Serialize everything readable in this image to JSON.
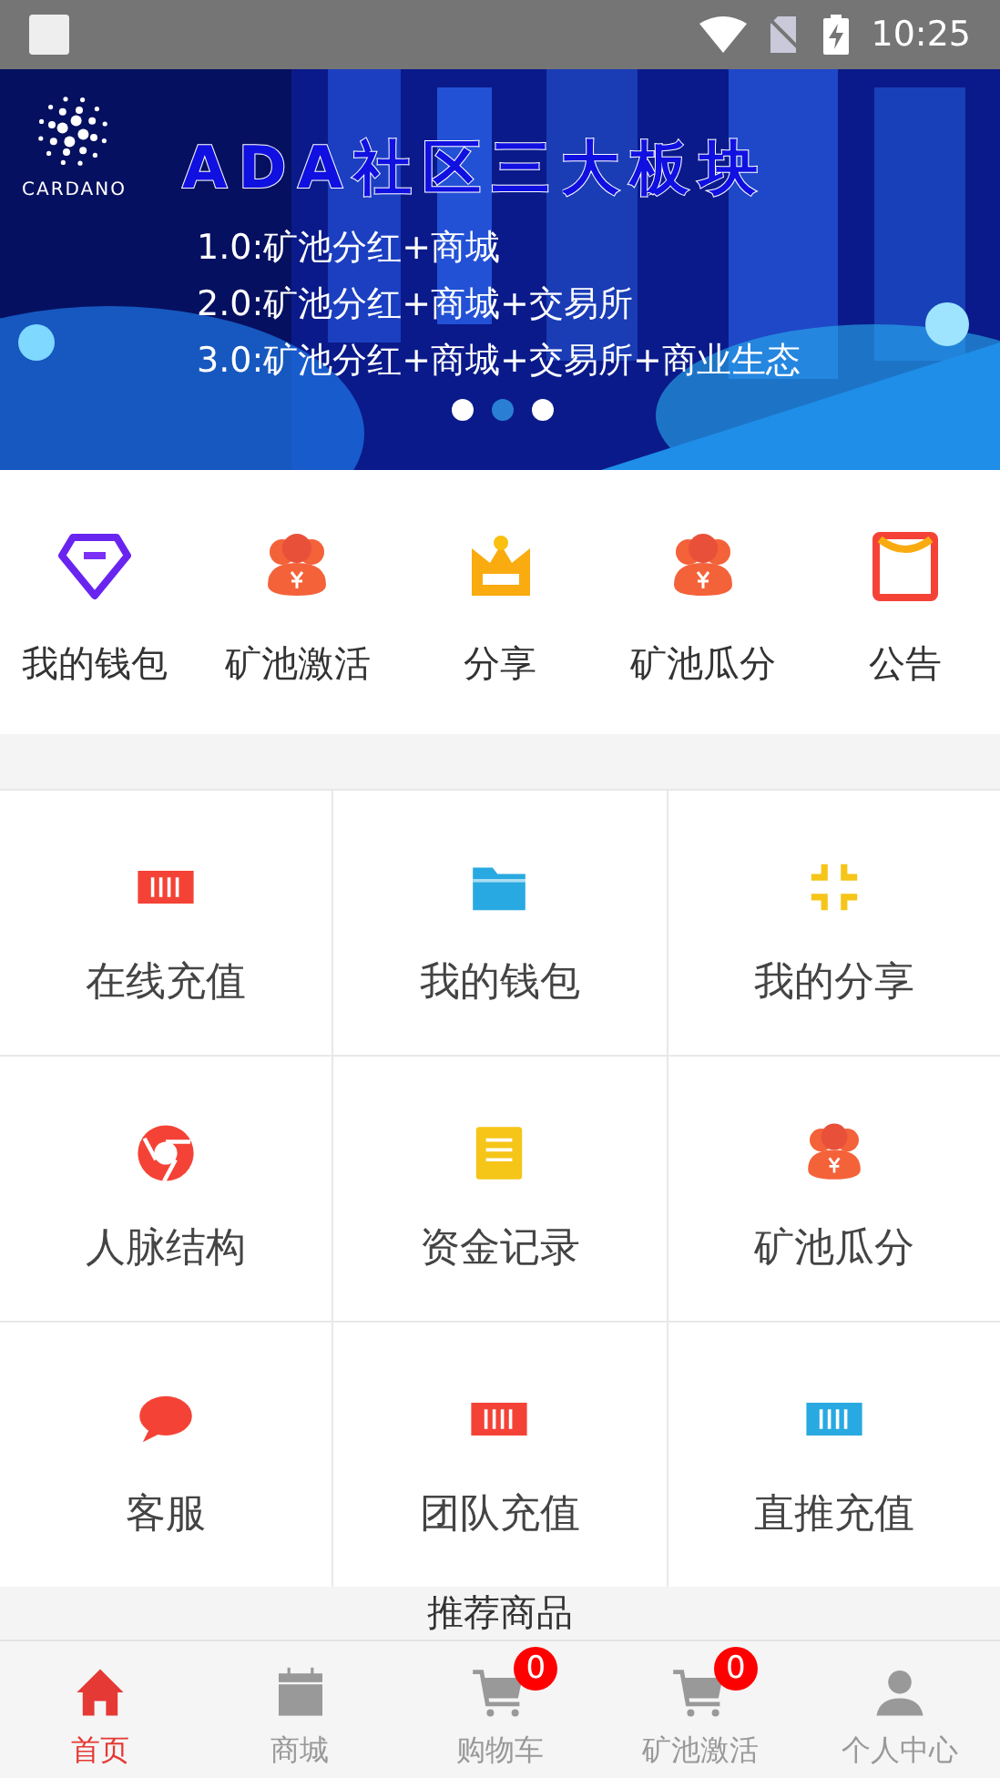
{
  "status_bar": {
    "time": "10:25"
  },
  "banner": {
    "logo_text": "CARDANO",
    "headline": "ADA社区三大板块",
    "lines": [
      "1.0:矿池分红+商城",
      "2.0:矿池分红+商城+交易所",
      "3.0:矿池分红+商城+交易所+商业生态"
    ],
    "dots": [
      {
        "selected": false
      },
      {
        "selected": true
      },
      {
        "selected": false
      }
    ]
  },
  "quick_menu": [
    {
      "label": "我的钱包",
      "kind": "diamond"
    },
    {
      "label": "矿池激活",
      "kind": "group"
    },
    {
      "label": "分享",
      "kind": "crown"
    },
    {
      "label": "矿池瓜分",
      "kind": "group"
    },
    {
      "label": "公告",
      "kind": "envelope"
    }
  ],
  "grid": [
    {
      "label": "在线充值",
      "kind": "card",
      "color": "#f44336"
    },
    {
      "label": "我的钱包",
      "kind": "folder",
      "color": "#29a9e1"
    },
    {
      "label": "我的分享",
      "kind": "shrink",
      "color": "#f5c518"
    },
    {
      "label": "人脉结构",
      "kind": "chrome",
      "color": "#f44336"
    },
    {
      "label": "资金记录",
      "kind": "note",
      "color": "#f5c518"
    },
    {
      "label": "矿池瓜分",
      "kind": "group",
      "color": "#f4623a"
    },
    {
      "label": "客服",
      "kind": "chat",
      "color": "#f44336"
    },
    {
      "label": "团队充值",
      "kind": "card",
      "color": "#f44336"
    },
    {
      "label": "直推充值",
      "kind": "card",
      "color": "#29a9e1"
    }
  ],
  "section_title": "推荐商品",
  "tabs": [
    {
      "label": "首页",
      "kind": "home",
      "selected": true
    },
    {
      "label": "商城",
      "kind": "calendar",
      "selected": false
    },
    {
      "label": "购物车",
      "kind": "cart",
      "selected": false,
      "badge": "0"
    },
    {
      "label": "矿池激活",
      "kind": "cart",
      "selected": false,
      "badge": "0"
    },
    {
      "label": "个人中心",
      "kind": "person",
      "selected": false
    }
  ]
}
